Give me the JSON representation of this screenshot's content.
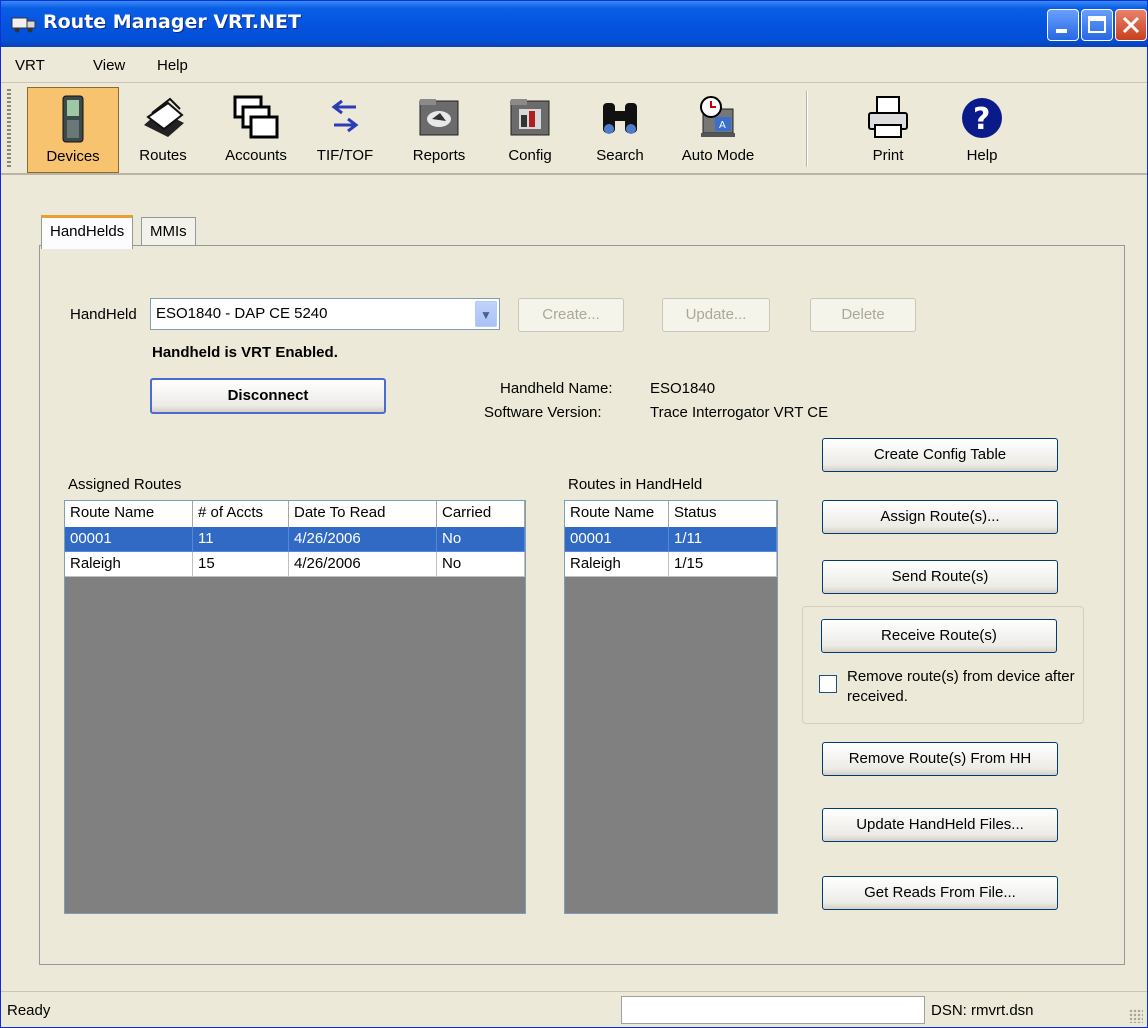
{
  "window": {
    "title": "Route Manager VRT.NET"
  },
  "menu": [
    "VRT",
    "View",
    "Help"
  ],
  "toolbar": {
    "items": [
      {
        "label": "Devices",
        "icon": "handheld-device-icon"
      },
      {
        "label": "Routes",
        "icon": "card-file-icon"
      },
      {
        "label": "Accounts",
        "icon": "stacked-windows-icon"
      },
      {
        "label": "TIF/TOF",
        "icon": "transfer-arrows-icon"
      },
      {
        "label": "Reports",
        "icon": "reports-folder-icon"
      },
      {
        "label": "Config",
        "icon": "config-folder-icon"
      },
      {
        "label": "Search",
        "icon": "binoculars-icon"
      },
      {
        "label": "Auto Mode",
        "icon": "auto-mode-clock-icon"
      },
      {
        "label": "Print",
        "icon": "printer-icon"
      },
      {
        "label": "Help",
        "icon": "help-question-icon"
      }
    ]
  },
  "tabs": [
    "HandHelds",
    "MMIs"
  ],
  "handheld": {
    "label": "HandHeld",
    "selected": "ESO1840 - DAP CE 5240",
    "create_label": "Create...",
    "update_label": "Update...",
    "delete_label": "Delete",
    "vrt_status": "Handheld is VRT Enabled.",
    "disconnect_label": "Disconnect",
    "name_label": "Handheld Name:",
    "name_value": "ESO1840",
    "version_label": "Software Version:",
    "version_value": "Trace Interrogator VRT CE"
  },
  "assigned": {
    "title": "Assigned Routes",
    "columns": [
      "Route Name",
      "# of Accts",
      "Date To Read",
      "Carried"
    ],
    "rows": [
      [
        "00001",
        "11",
        "4/26/2006",
        "No"
      ],
      [
        "Raleigh",
        "15",
        "4/26/2006",
        "No"
      ]
    ]
  },
  "inhandheld": {
    "title": "Routes in HandHeld",
    "columns": [
      "Route Name",
      "Status"
    ],
    "rows": [
      [
        "00001",
        "1/11"
      ],
      [
        "Raleigh",
        "1/15"
      ]
    ]
  },
  "actions": {
    "create_config": "Create Config Table",
    "assign": "Assign Route(s)...",
    "send": "Send Route(s)",
    "receive": "Receive Route(s)",
    "remove_after_label": "Remove route(s) from device after received.",
    "remove_from_hh": "Remove Route(s) From HH",
    "update_files": "Update HandHeld Files...",
    "get_reads": "Get Reads From File..."
  },
  "status": {
    "left": "Ready",
    "middle": "",
    "dsn": "DSN: rmvrt.dsn"
  }
}
